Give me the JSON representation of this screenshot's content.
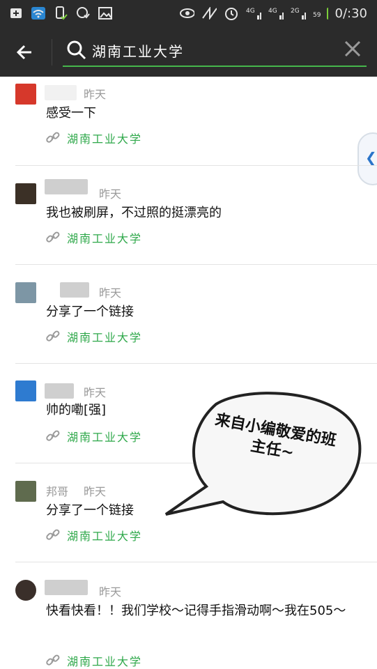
{
  "status_bar": {
    "time": "0/:30",
    "battery": "59",
    "network": [
      "4G",
      "4G",
      "2G"
    ]
  },
  "header": {
    "search_text": "湖南工业大学"
  },
  "items": [
    {
      "time": "昨天",
      "content": "感受一下",
      "link": "湖南工业大学"
    },
    {
      "time": "昨天",
      "content": "我也被刷屏，不过照的挺漂亮的",
      "link": "湖南工业大学"
    },
    {
      "time": "昨天",
      "content": "分享了一个链接",
      "link": "湖南工业大学"
    },
    {
      "time": "昨天",
      "content": "帅的嘞[强]",
      "link": "湖南工业大学"
    },
    {
      "name": "邦哥",
      "time": "昨天",
      "content": "分享了一个链接",
      "link": "湖南工业大学"
    },
    {
      "time": "昨天",
      "content": "快看快看！！我们学校～记得手指滑动啊～我在505～",
      "link": "湖南工业大学"
    }
  ],
  "overlay": {
    "bubble_text": "来自小编敬爱的班主任~"
  },
  "colors": {
    "bar": "#2b2b2b",
    "accent": "#2ea84a",
    "time": "#9a9a9a"
  }
}
